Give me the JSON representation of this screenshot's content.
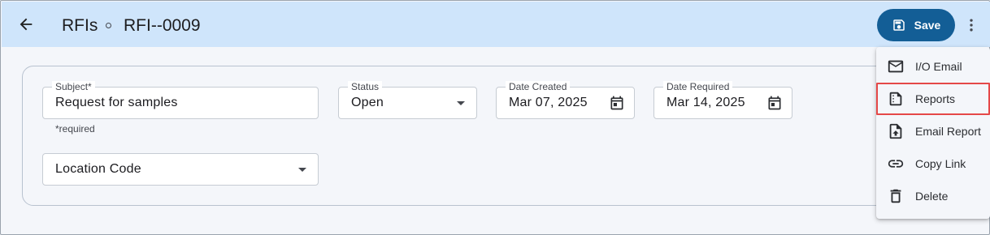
{
  "header": {
    "back_icon": "arrow-left-icon",
    "breadcrumb_root": "RFIs",
    "breadcrumb_current": "RFI--0009",
    "save_label": "Save",
    "save_icon": "floppy-disk-icon",
    "more_icon": "more-vertical-icon",
    "colors": {
      "header_bg": "#cfe5fb",
      "save_bg": "#135e96"
    }
  },
  "form": {
    "subject": {
      "label": "Subject*",
      "value": "Request for samples",
      "helper": "*required"
    },
    "status": {
      "label": "Status",
      "value": "Open"
    },
    "date_created": {
      "label": "Date Created",
      "value": "Mar 07, 2025"
    },
    "date_required": {
      "label": "Date Required",
      "value": "Mar 14, 2025"
    },
    "location_code": {
      "label": "",
      "value": "Location Code"
    }
  },
  "menu": {
    "items": [
      {
        "label": "I/O Email",
        "icon": "mail-icon"
      },
      {
        "label": "Reports",
        "icon": "report-icon",
        "highlighted": true,
        "highlight_color": "#e54848"
      },
      {
        "label": "Email Report",
        "icon": "file-upload-icon"
      },
      {
        "label": "Copy Link",
        "icon": "link-icon"
      },
      {
        "label": "Delete",
        "icon": "trash-icon"
      }
    ]
  }
}
